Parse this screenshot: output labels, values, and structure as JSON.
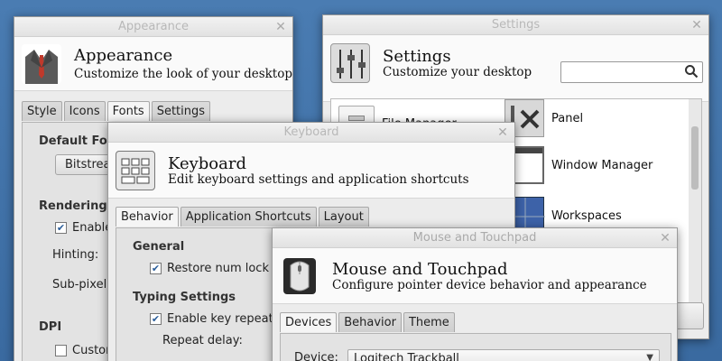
{
  "appearance": {
    "window_title": "Appearance",
    "title": "Appearance",
    "subtitle": "Customize the look of your desktop",
    "tabs": [
      "Style",
      "Icons",
      "Fonts",
      "Settings"
    ],
    "active_tab": "Fonts",
    "default_font_label": "Default Fo",
    "default_font_value": "Bitstrea",
    "rendering_label": "Rendering",
    "enable_label": "Enable",
    "hinting_label": "Hinting:",
    "subpixel_label": "Sub-pixel",
    "dpi_label": "DPI",
    "custom_label": "Custom"
  },
  "settings": {
    "window_title": "Settings",
    "title": "Settings",
    "subtitle": "Customize your desktop",
    "search_placeholder": "",
    "items": [
      {
        "label": "File Manager",
        "icon": "file-manager-icon"
      },
      {
        "label": "Panel",
        "icon": "panel-icon"
      },
      {
        "label": "Window Manager",
        "icon": "window-manager-icon"
      },
      {
        "label": "Workspaces",
        "icon": "workspaces-icon"
      }
    ]
  },
  "keyboard": {
    "window_title": "Keyboard",
    "title": "Keyboard",
    "subtitle": "Edit keyboard settings and application shortcuts",
    "tabs": [
      "Behavior",
      "Application Shortcuts",
      "Layout"
    ],
    "active_tab": "Behavior",
    "general_label": "General",
    "restore_numlock_label": "Restore num lock s",
    "typing_settings_label": "Typing Settings",
    "enable_key_repeat_label": "Enable key repeat",
    "repeat_delay_label": "Repeat delay:"
  },
  "mouse": {
    "window_title": "Mouse and Touchpad",
    "title": "Mouse and Touchpad",
    "subtitle": "Configure pointer device behavior and appearance",
    "tabs": [
      "Devices",
      "Behavior",
      "Theme"
    ],
    "active_tab": "Devices",
    "device_label": "Device:",
    "device_value": "Logitech Trackball"
  },
  "colors": {
    "desktop": "#3d6fa5",
    "check_color": "#2a5d9a"
  }
}
